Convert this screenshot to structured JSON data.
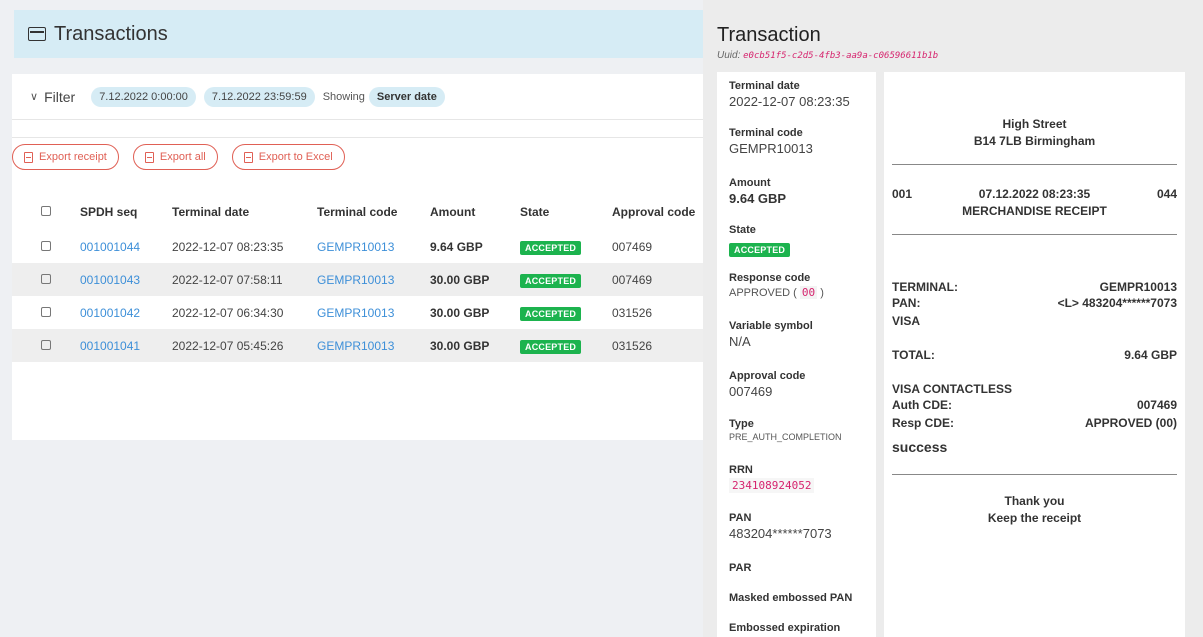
{
  "page": {
    "title": "Transactions"
  },
  "filter": {
    "label": "Filter",
    "date_from": "7.12.2022 0:00:00",
    "date_to": "7.12.2022 23:59:59",
    "showing_label": "Showing",
    "showing_value": "Server date"
  },
  "export": {
    "receipt": "Export receipt",
    "all": "Export all",
    "excel": "Export to Excel"
  },
  "table": {
    "headers": [
      "SPDH seq",
      "Terminal date",
      "Terminal code",
      "Amount",
      "State",
      "Approval code"
    ],
    "rows": [
      {
        "seq": "001001044",
        "date": "2022-12-07 08:23:35",
        "code": "GEMPR10013",
        "amount": "9.64 GBP",
        "state": "ACCEPTED",
        "approval": "007469"
      },
      {
        "seq": "001001043",
        "date": "2022-12-07 07:58:11",
        "code": "GEMPR10013",
        "amount": "30.00 GBP",
        "state": "ACCEPTED",
        "approval": "007469"
      },
      {
        "seq": "001001042",
        "date": "2022-12-07 06:34:30",
        "code": "GEMPR10013",
        "amount": "30.00 GBP",
        "state": "ACCEPTED",
        "approval": "031526"
      },
      {
        "seq": "001001041",
        "date": "2022-12-07 05:45:26",
        "code": "GEMPR10013",
        "amount": "30.00 GBP",
        "state": "ACCEPTED",
        "approval": "031526"
      }
    ]
  },
  "detail": {
    "title": "Transaction",
    "uuid_label": "Uuid:",
    "uuid": "e0cb51f5-c2d5-4fb3-aa9a-c06596611b1b",
    "terminal_date_label": "Terminal date",
    "terminal_date": "2022-12-07 08:23:35",
    "terminal_code_label": "Terminal code",
    "terminal_code": "GEMPR10013",
    "amount_label": "Amount",
    "amount": "9.64 GBP",
    "state_label": "State",
    "state": "ACCEPTED",
    "response_code_label": "Response code",
    "response_text": "APPROVED (",
    "response_code": "00",
    "response_close": ")",
    "variable_symbol_label": "Variable symbol",
    "variable_symbol": "N/A",
    "approval_code_label": "Approval code",
    "approval_code": "007469",
    "type_label": "Type",
    "type": "PRE_AUTH_COMPLETION",
    "rrn_label": "RRN",
    "rrn": "234108924052",
    "pan_label": "PAN",
    "pan": "483204******7073",
    "par_label": "PAR",
    "masked_pan_label": "Masked embossed PAN",
    "embossed_exp_label": "Embossed expiration"
  },
  "receipt": {
    "line1": "High Street",
    "line2": "B14 7LB Birmingham",
    "num_left": "001",
    "datetime": "07.12.2022 08:23:35",
    "num_right": "044",
    "receipt_type": "MERCHANDISE RECEIPT",
    "terminal_label": "TERMINAL:",
    "terminal_value": "GEMPR10013",
    "pan_label": "PAN:",
    "pan_value": "<L> 483204******7073",
    "card_scheme": "VISA",
    "total_label": "TOTAL:",
    "total_value": "9.64 GBP",
    "contactless": "VISA CONTACTLESS",
    "auth_label": "Auth CDE:",
    "auth_value": "007469",
    "resp_label": "Resp CDE:",
    "resp_value": "APPROVED (00)",
    "result": "success",
    "thanks1": "Thank you",
    "thanks2": "Keep the receipt"
  },
  "colors": {
    "accent": "#3d8fd8",
    "danger": "#e06055",
    "success": "#1cb34e",
    "header_bg": "#d6ecf5"
  }
}
